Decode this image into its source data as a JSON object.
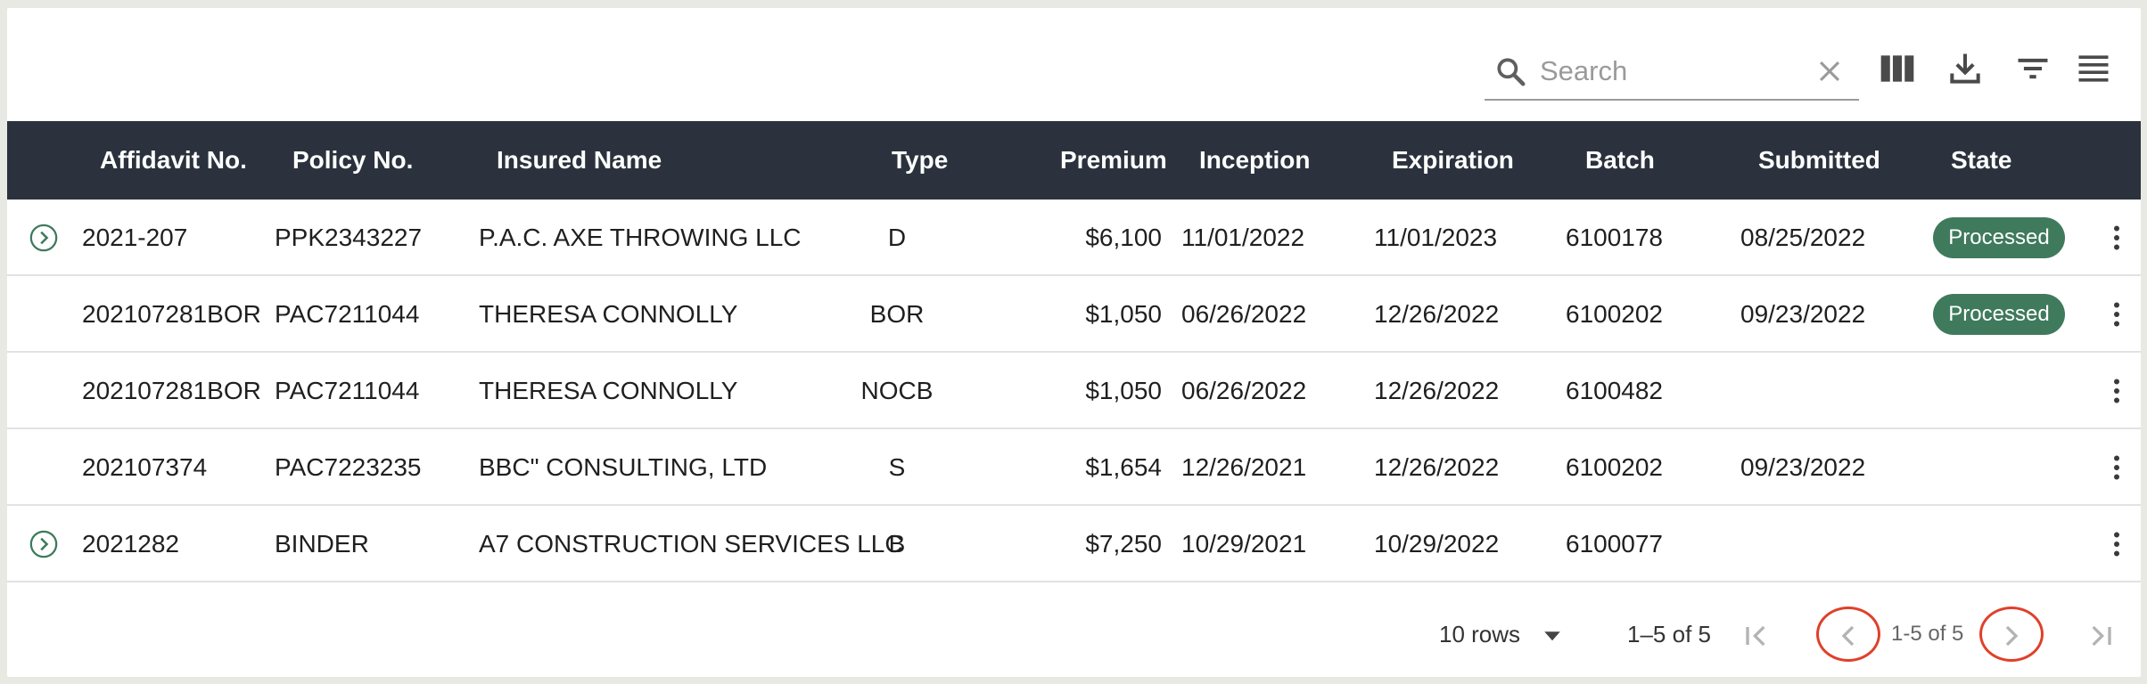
{
  "search": {
    "placeholder": "Search",
    "value": ""
  },
  "toolbar": {
    "icons": [
      "search-icon",
      "close-icon",
      "view-columns-icon",
      "download-icon",
      "filter-icon",
      "density-icon"
    ]
  },
  "table": {
    "headers": {
      "affidavit": "Affidavit No.",
      "policy": "Policy No.",
      "insured": "Insured Name",
      "type": "Type",
      "premium": "Premium",
      "inception": "Inception",
      "expiration": "Expiration",
      "batch": "Batch",
      "submitted": "Submitted",
      "state": "State"
    },
    "rows": [
      {
        "affidavit": "2021-207",
        "policy": "PPK2343227",
        "insured": "P.A.C. AXE THROWING LLC",
        "type": "D",
        "premium": "$6,100",
        "inception": "11/01/2022",
        "expiration": "11/01/2023",
        "batch": "6100178",
        "submitted": "08/25/2022",
        "state": "Processed"
      },
      {
        "affidavit": "202107281BOR",
        "policy": "PAC7211044",
        "insured": "THERESA CONNOLLY",
        "type": "BOR",
        "premium": "$1,050",
        "inception": "06/26/2022",
        "expiration": "12/26/2022",
        "batch": "6100202",
        "submitted": "09/23/2022",
        "state": "Processed"
      },
      {
        "affidavit": "202107281BOR",
        "policy": "PAC7211044",
        "insured": "THERESA CONNOLLY",
        "type": "NOCB",
        "premium": "$1,050",
        "inception": "06/26/2022",
        "expiration": "12/26/2022",
        "batch": "6100482",
        "submitted": "",
        "state": ""
      },
      {
        "affidavit": "202107374",
        "policy": "PAC7223235",
        "insured": "BBC\" CONSULTING, LTD",
        "type": "S",
        "premium": "$1,654",
        "inception": "12/26/2021",
        "expiration": "12/26/2022",
        "batch": "6100202",
        "submitted": "09/23/2022",
        "state": ""
      },
      {
        "affidavit": "2021282",
        "policy": "BINDER",
        "insured": "A7 CONSTRUCTION SERVICES LLC",
        "type": "B",
        "premium": "$7,250",
        "inception": "10/29/2021",
        "expiration": "10/29/2022",
        "batch": "6100077",
        "submitted": "",
        "state": ""
      }
    ]
  },
  "footer": {
    "rows_per_page": "10 rows",
    "range": "1–5 of 5",
    "page_range": "1-5 of 5"
  },
  "colors": {
    "header_bg": "#2b323d",
    "badge_bg": "#3f7a5c",
    "expand_icon": "#3f7a5c",
    "highlight_circle": "#e0402a"
  }
}
